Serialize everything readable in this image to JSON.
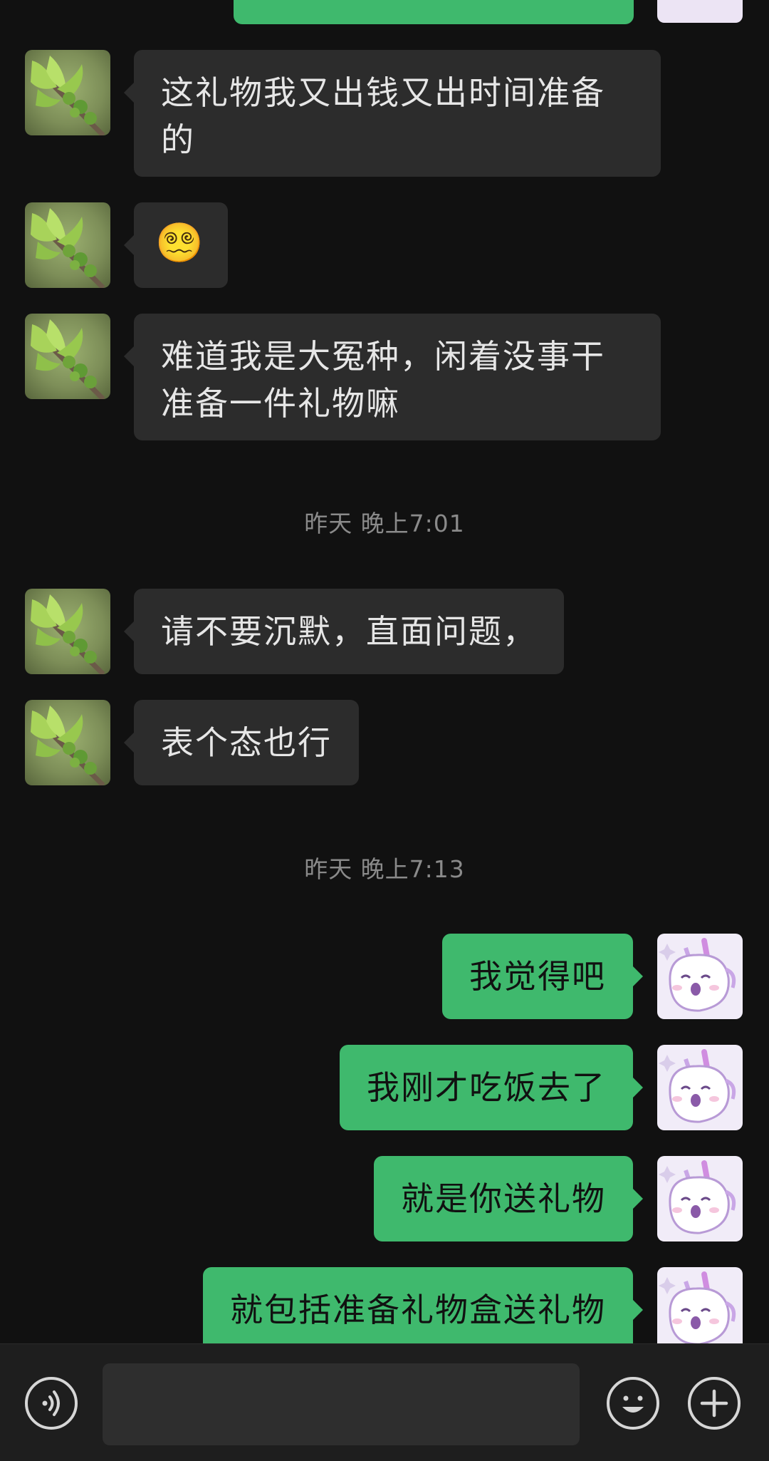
{
  "messages": [
    {
      "sender": "contact",
      "text": "这礼物我又出钱又出时间准备的"
    },
    {
      "sender": "contact",
      "text": "😵‍💫"
    },
    {
      "sender": "contact",
      "text": "难道我是大冤种，闲着没事干准备一件礼物嘛"
    },
    {
      "type": "timestamp",
      "text": "昨天 晚上7:01"
    },
    {
      "sender": "contact",
      "text": "请不要沉默，直面问题，"
    },
    {
      "sender": "contact",
      "text": "表个态也行"
    },
    {
      "type": "timestamp",
      "text": "昨天 晚上7:13"
    },
    {
      "sender": "self",
      "text": "我觉得吧"
    },
    {
      "sender": "self",
      "text": "我刚才吃饭去了"
    },
    {
      "sender": "self",
      "text": "就是你送礼物"
    },
    {
      "sender": "self",
      "text": "就包括准备礼物盒送礼物"
    }
  ],
  "input_bar": {
    "text_value": "",
    "voice_icon": "voice-icon",
    "emoji_icon": "emoji-icon",
    "plus_icon": "plus-icon"
  },
  "colors": {
    "background": "#111111",
    "incoming_bubble": "#2c2c2c",
    "outgoing_bubble": "#3fb96d",
    "timestamp_text": "#8a8a8a"
  },
  "avatars": {
    "contact": "leaf-avatar",
    "self": "unicorn-cat-avatar"
  }
}
